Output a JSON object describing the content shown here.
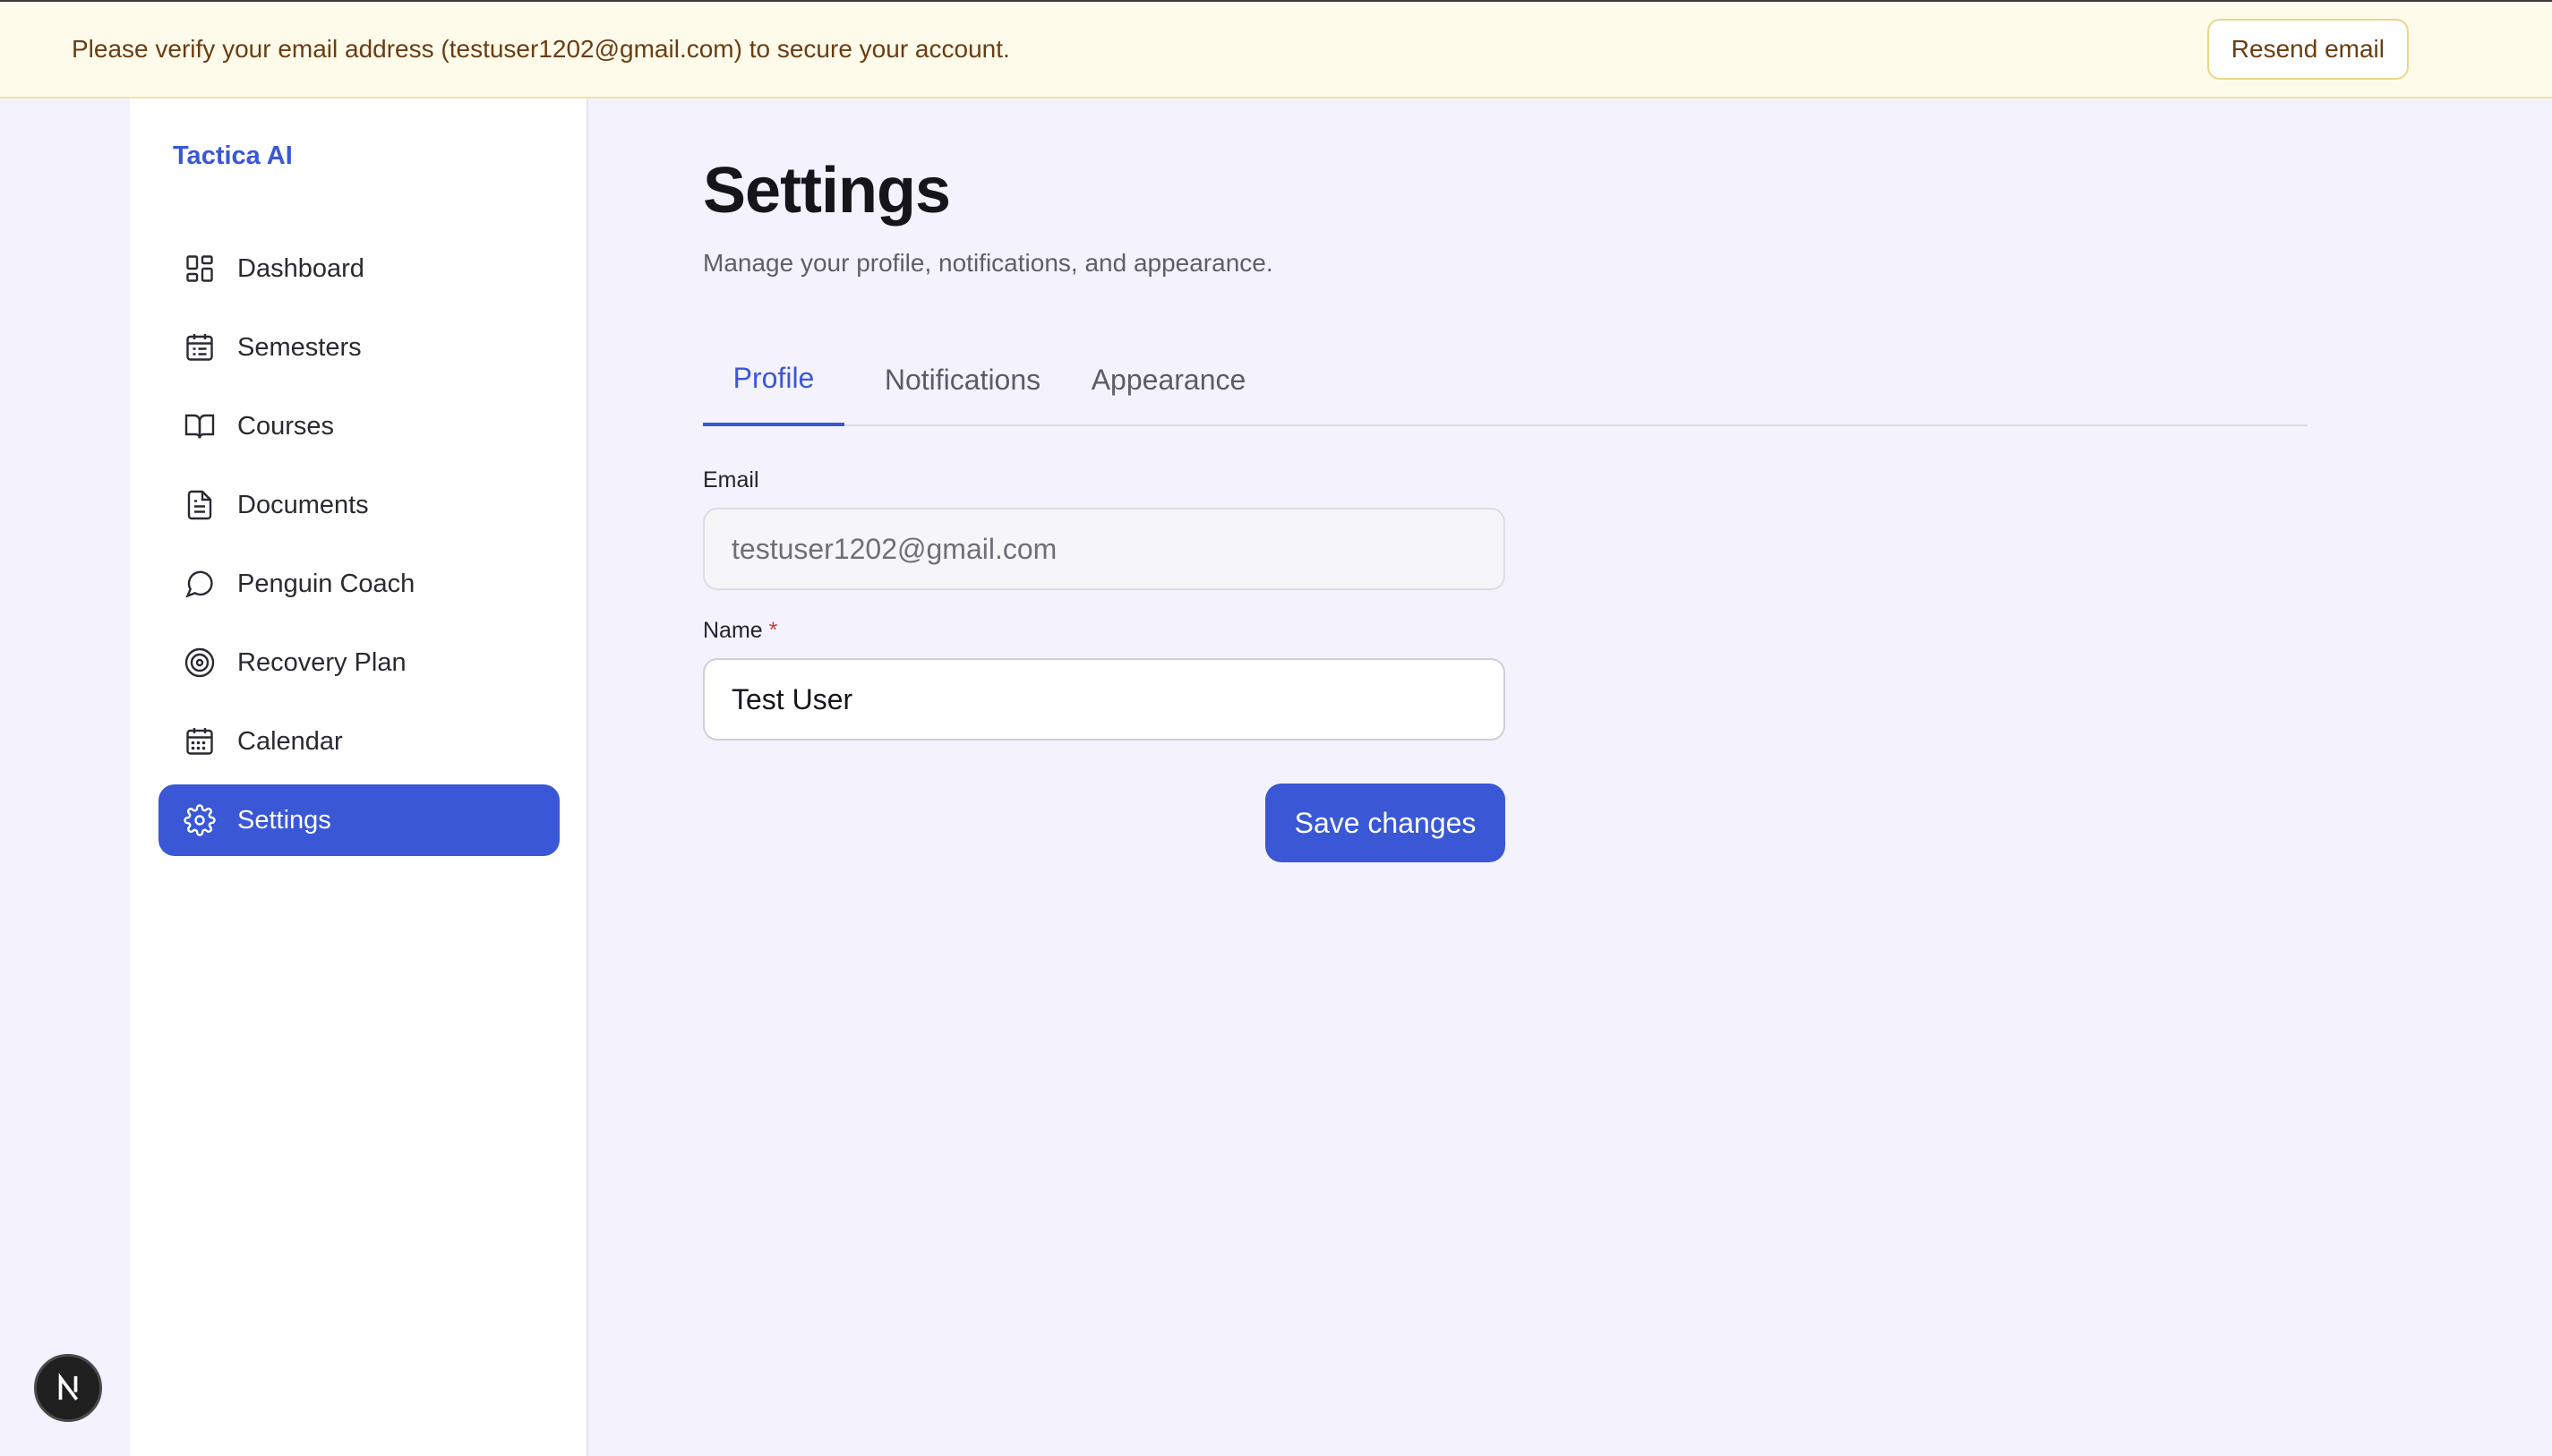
{
  "banner": {
    "message": "Please verify your email address (testuser1202@gmail.com) to secure your account.",
    "resend_label": "Resend email"
  },
  "sidebar": {
    "brand": "Tactica AI",
    "items": [
      {
        "label": "Dashboard",
        "icon": "dashboard-icon"
      },
      {
        "label": "Semesters",
        "icon": "calendar-list-icon"
      },
      {
        "label": "Courses",
        "icon": "book-icon"
      },
      {
        "label": "Documents",
        "icon": "document-icon"
      },
      {
        "label": "Penguin Coach",
        "icon": "chat-bubble-icon"
      },
      {
        "label": "Recovery Plan",
        "icon": "target-icon"
      },
      {
        "label": "Calendar",
        "icon": "calendar-icon"
      },
      {
        "label": "Settings",
        "icon": "gear-icon",
        "active": true
      }
    ]
  },
  "page": {
    "title": "Settings",
    "subtitle": "Manage your profile, notifications, and appearance."
  },
  "tabs": [
    {
      "label": "Profile",
      "active": true
    },
    {
      "label": "Notifications"
    },
    {
      "label": "Appearance"
    }
  ],
  "form": {
    "email_label": "Email",
    "email_value": "testuser1202@gmail.com",
    "name_label": "Name",
    "name_required_mark": "*",
    "name_value": "Test User",
    "save_label": "Save changes"
  },
  "fab": {
    "icon": "n-logo-icon"
  },
  "colors": {
    "accent": "#3a57d6",
    "banner_bg": "#fefbeb",
    "banner_text": "#6b3d12",
    "page_bg": "#f4f3fd"
  }
}
